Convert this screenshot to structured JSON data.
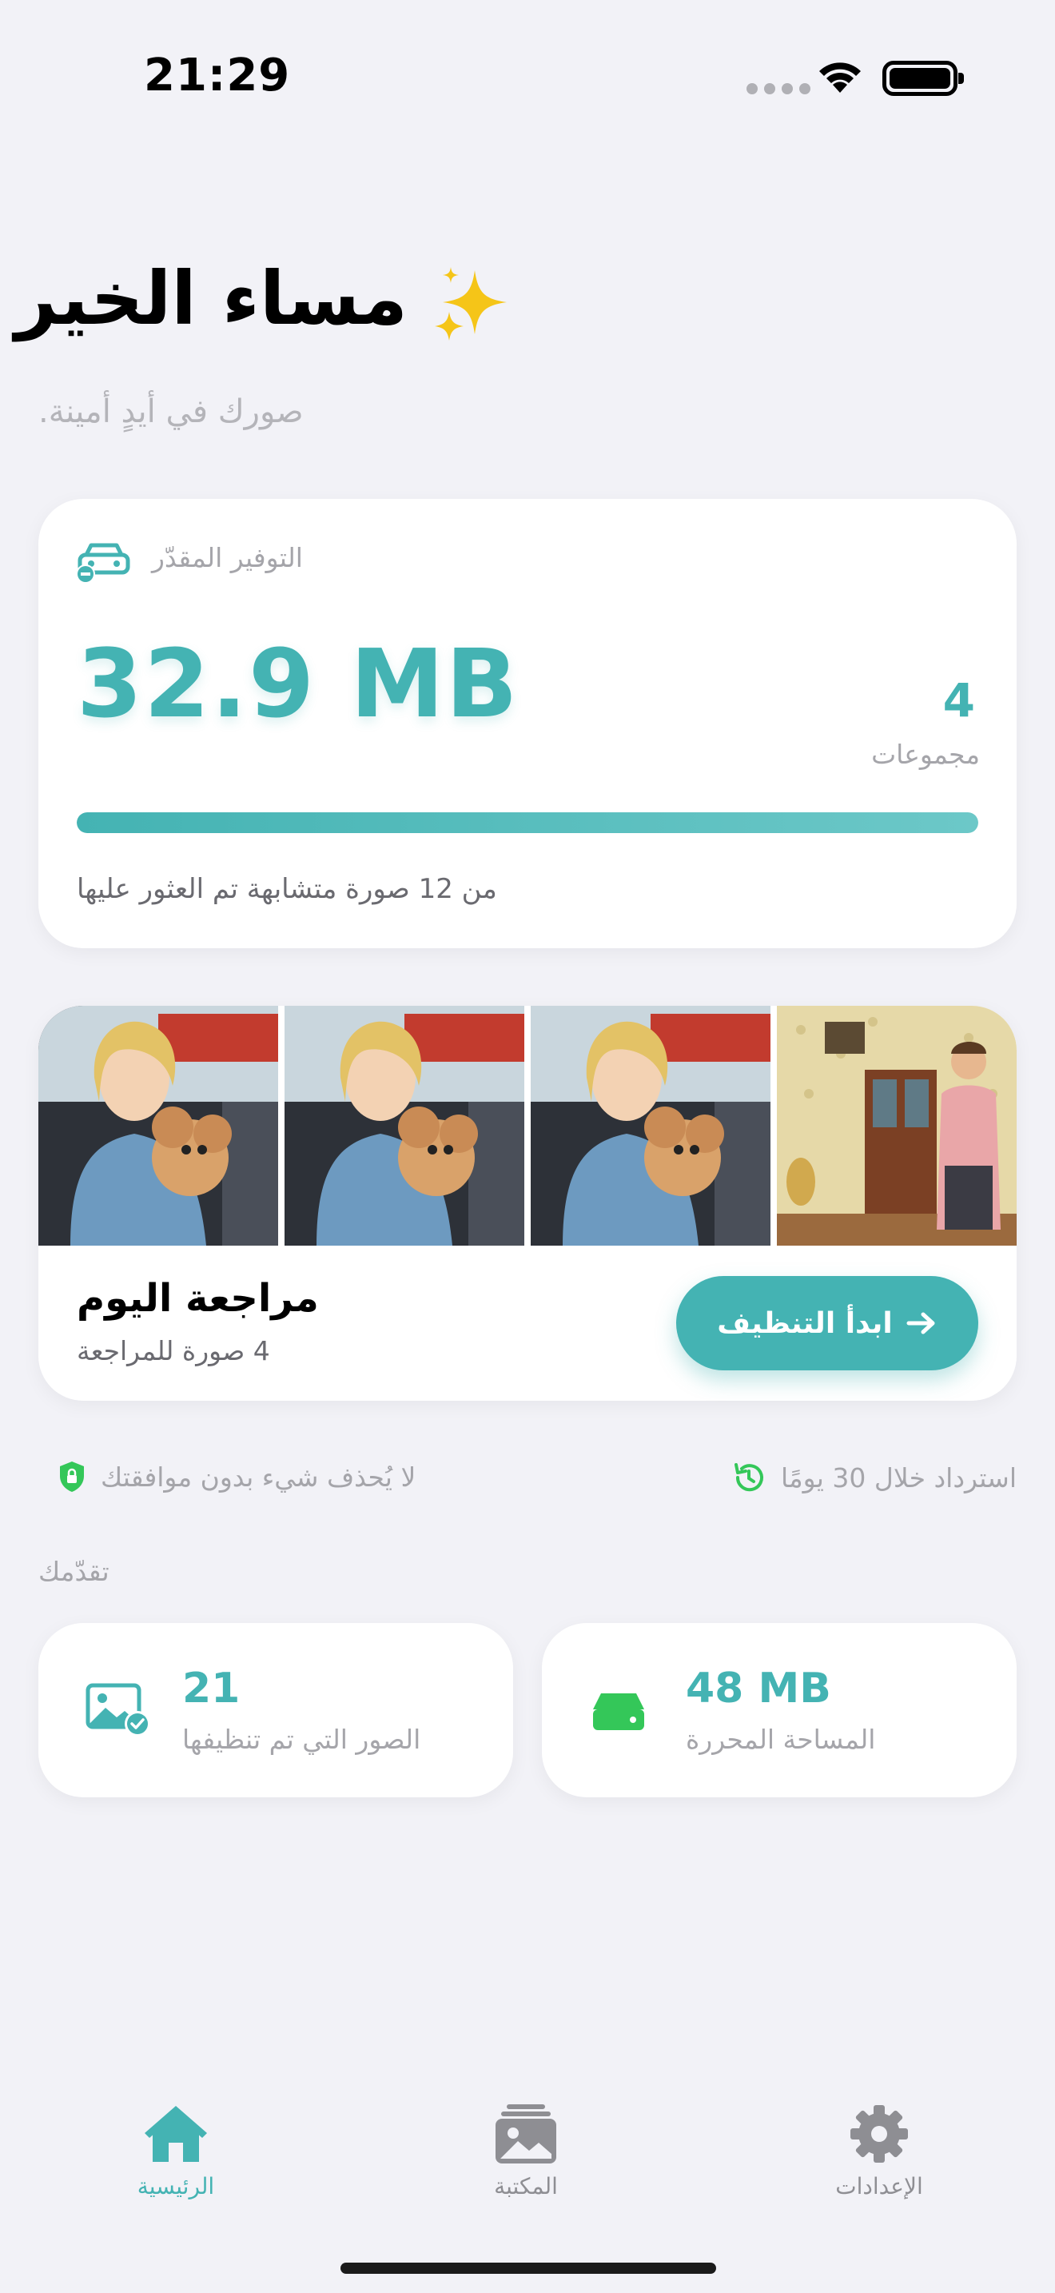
{
  "status_bar": {
    "time": "21:29"
  },
  "header": {
    "greeting": "مساء الخير",
    "subtitle": "صورك في أيدٍ أمينة."
  },
  "savings": {
    "label": "التوفير المقدّر",
    "value": "32.9 MB",
    "groups_count": "4",
    "groups_label": "مجموعات",
    "progress": 1.0,
    "found_text": "من 12 صورة متشابهة تم العثور عليها"
  },
  "review": {
    "title": "مراجعة اليوم",
    "subtitle": "4 صورة للمراجعة",
    "start_button": "ابدأ التنظيف",
    "thumbnails": [
      "girl-with-puppy",
      "girl-with-puppy",
      "girl-with-puppy",
      "man-in-living-room"
    ]
  },
  "info": {
    "recovery": "استرداد خلال 30 يومًا",
    "no_delete": "لا يُحذف شيء بدون موافقتك"
  },
  "progress_section": {
    "heading": "تقدّمك",
    "cleaned_photos": {
      "value": "21",
      "label": "الصور التي تم تنظيفها"
    },
    "freed_space": {
      "value": "48 MB",
      "label": "المساحة المحررة"
    }
  },
  "tab_bar": {
    "home": "الرئيسية",
    "library": "المكتبة",
    "settings": "الإعدادات",
    "active": "home"
  },
  "colors": {
    "accent": "#44b3b3",
    "green": "#34c759",
    "background": "#f2f2f7"
  }
}
